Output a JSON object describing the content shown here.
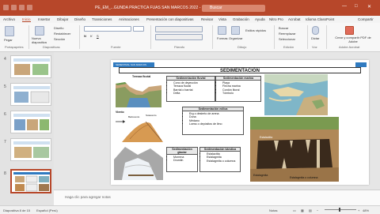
{
  "window": {
    "title": "PE_EM_...GUNDA PRACTICA FUAS SAN MARCOS 2022 - PowerPoint",
    "search_placeholder": "Buscar",
    "accent": "#b7472a"
  },
  "menu": {
    "items": [
      "Archivo",
      "Inicio",
      "Insertar",
      "Dibujar",
      "Diseño",
      "Transiciones",
      "Animaciones",
      "Presentación con diapositivas",
      "Revisar",
      "Vista",
      "Grabación",
      "Ayuda",
      "Nitro Pro",
      "Acrobat",
      "Idioma ClassPoint"
    ],
    "share": "Compartir"
  },
  "ribbon": {
    "paste": "Pegar",
    "new_slide": "Nueva diapositiva",
    "layout": "Diseño",
    "reset": "Restablecer",
    "section": "Sección",
    "shapes": "Formas",
    "arrange": "Organizar",
    "quick_styles": "Estilos rápidos",
    "find": "Buscar",
    "replace": "Reemplazar",
    "select": "Seleccionar",
    "dictate": "Dictar",
    "adobe_pdf": "Crear y compartir PDF de Adobe",
    "groups": [
      "Portapapeles",
      "Diapositivas",
      "Fuente",
      "Párrafo",
      "Dibujo",
      "Edición",
      "Voz",
      "Adobe Acrobat"
    ]
  },
  "thumbnails": [
    {
      "num": "4"
    },
    {
      "num": "5"
    },
    {
      "num": "6"
    },
    {
      "num": "7"
    },
    {
      "num": "8"
    }
  ],
  "slide": {
    "title": "SEDIMENTACIÓN",
    "header_badge": "SEMESTRAL SAN MARCOS",
    "fluvial": {
      "caption": "Terraza fluvial",
      "header": "Sedimentación fluvial",
      "items": [
        "Cono de deyección",
        "Terraza fluvial",
        "Barrial o barrial",
        "Delta"
      ]
    },
    "marina": {
      "header": "Sedimentación marina",
      "items": [
        "Playa",
        "Flecha marina",
        "Cordón litoral",
        "Tómbolo"
      ]
    },
    "eolica": {
      "header": "Sedimentación eólica",
      "items": [
        "Erg o desierto de arena",
        "Duna",
        "Médano",
        "Loess o depósitos de limo"
      ],
      "labels": [
        "Viento",
        "Barlovento",
        "Sotavento"
      ]
    },
    "glaciar": {
      "header": "Sedimentación glaciar",
      "items": [
        "Morrena",
        "Drumlin"
      ]
    },
    "karstica": {
      "header": "Sedimentación kárstica",
      "items": [
        "Estalactita",
        "Estalagmita",
        "Estalagmita o columna"
      ],
      "labels": [
        "Estalactita",
        "Estalagmita",
        "Estalagmita o columna"
      ]
    }
  },
  "notes_placeholder": "Haga clic para agregar notas",
  "status": {
    "slide_info": "Diapositiva 8 de 15",
    "language": "Español (Perú)",
    "notes": "Notas",
    "zoom": "48%"
  }
}
